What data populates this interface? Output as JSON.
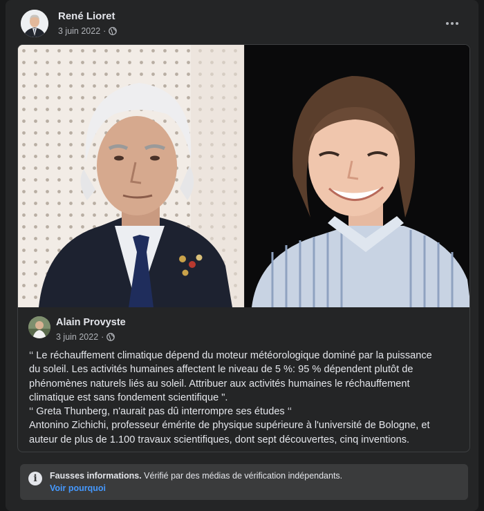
{
  "post": {
    "author": "René Lioret",
    "date": "3 juin 2022",
    "privacy_icon": "globe-icon",
    "more_icon": "ellipsis-icon"
  },
  "shared": {
    "author": "Alain Provyste",
    "date": "3 juin 2022",
    "privacy_icon": "globe-icon",
    "text_lines": [
      "‘‘ Le réchauffement climatique dépend du moteur météorologique dominé par la puissance",
      "du soleil. Les activités humaines affectent le niveau de 5 %: 95 % dépendent plutôt de",
      "phénomènes naturels liés au soleil. Attribuer aux activités humaines le réchauffement",
      "climatique est sans fondement scientifique \".",
      "‘‘ Greta Thunberg, n'aurait pas dû interrompre ses études ‘‘",
      "Antonino Zichichi, professeur émérite de physique supérieure à l'université de Bologne, et",
      "auteur de plus de 1.100 travaux scientifiques, dont sept découvertes, cinq inventions."
    ]
  },
  "fact_check": {
    "icon": "info-icon",
    "title": "Fausses informations.",
    "description": "Vérifié par des médias de vérification indépendants.",
    "link": "Voir pourquoi"
  },
  "colors": {
    "background": "#18191a",
    "card": "#242526",
    "text": "#e4e6eb",
    "secondary_text": "#b0b3b8",
    "link": "#4599ff",
    "factbox": "#3a3b3c"
  }
}
